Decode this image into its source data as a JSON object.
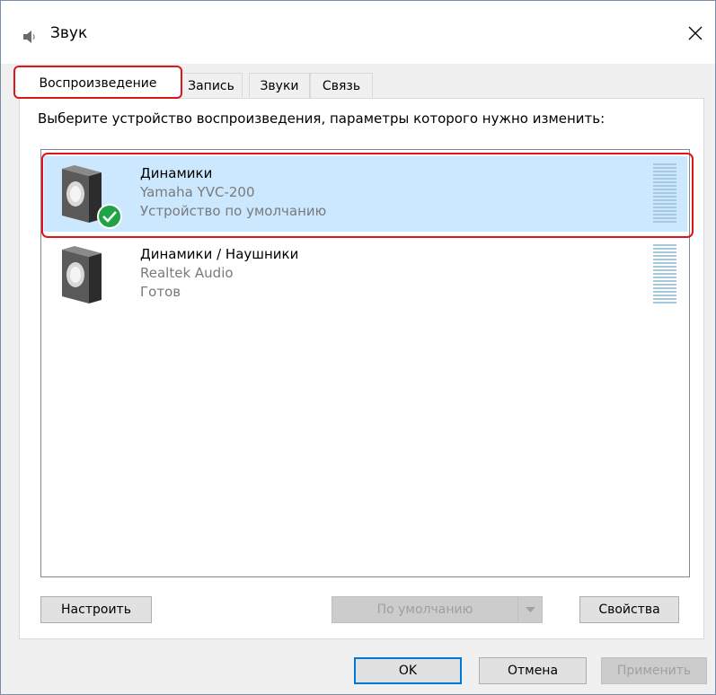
{
  "window": {
    "title": "Звук",
    "close_label": "×"
  },
  "tabs": [
    {
      "label": "Воспроизведение",
      "active": true
    },
    {
      "label": "Запись",
      "active": false
    },
    {
      "label": "Звуки",
      "active": false
    },
    {
      "label": "Связь",
      "active": false
    }
  ],
  "panel": {
    "prompt": "Выберите устройство воспроизведения, параметры которого нужно изменить:"
  },
  "devices": [
    {
      "name": "Динамики",
      "model": "Yamaha YVC-200",
      "status": "Устройство по умолчанию",
      "selected": true,
      "default": true,
      "icon": "speaker-icon",
      "level": 0
    },
    {
      "name": "Динамики / Наушники",
      "model": "Realtek Audio",
      "status": "Готов",
      "selected": false,
      "default": false,
      "icon": "speaker-icon",
      "level": 0
    }
  ],
  "buttons": {
    "configure": "Настроить",
    "set_default": "По умолчанию",
    "properties": "Свойства",
    "ok": "OK",
    "cancel": "Отмена",
    "apply": "Применить"
  },
  "colors": {
    "selection": "#cce8ff",
    "highlight_outline": "#e0141b",
    "default_badge": "#1fa345",
    "meter": "#a6c8dc"
  }
}
